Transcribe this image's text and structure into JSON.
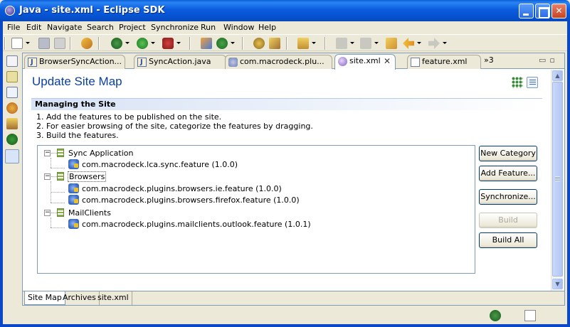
{
  "window": {
    "title": "Java - site.xml - Eclipse SDK"
  },
  "menubar": [
    "File",
    "Edit",
    "Navigate",
    "Search",
    "Project",
    "Synchronize",
    "Run",
    "Window",
    "Help"
  ],
  "toolbar_icons": [
    "new-icon",
    "save-icon",
    "print-icon",
    "refresh-icon",
    "debug-icon",
    "run-icon",
    "external-tools-icon",
    "open-type-icon",
    "new-class-icon",
    "search-icon",
    "open-task-icon",
    "open-perspective-icon",
    "next-annotation-icon",
    "previous-annotation-icon",
    "last-edit-icon",
    "back-icon",
    "forward-icon"
  ],
  "left_icons": [
    "package-explorer-icon",
    "junit-icon",
    "hierarchy-icon",
    "outline-icon",
    "problems-icon",
    "debug-view-icon",
    "java-perspective-icon"
  ],
  "tabs": [
    {
      "label": "BrowserSyncAction...",
      "icon": "java-file-icon"
    },
    {
      "label": "SyncAction.java",
      "icon": "java-file-icon"
    },
    {
      "label": "com.macrodeck.plu...",
      "icon": "plugin-icon"
    },
    {
      "label": "site.xml",
      "icon": "site-xml-icon",
      "active": true
    },
    {
      "label": "feature.xml",
      "icon": "feature-xml-icon"
    }
  ],
  "tab_overflow": "»3",
  "form": {
    "title": "Update Site Map",
    "section_title": "Managing the Site",
    "steps": [
      "1. Add the features to be published on the site.",
      "2. For easier browsing of the site, categorize the features by dragging.",
      "3. Build the features."
    ]
  },
  "tree": [
    {
      "type": "category",
      "label": "Sync Application",
      "children": [
        "com.macrodeck.lca.sync.feature (1.0.0)"
      ]
    },
    {
      "type": "category",
      "label": "Browsers",
      "selected": true,
      "children": [
        "com.macrodeck.plugins.browsers.ie.feature (1.0.0)",
        "com.macrodeck.plugins.browsers.firefox.feature (1.0.0)"
      ]
    },
    {
      "type": "category",
      "label": "MailClients",
      "children": [
        "com.macrodeck.plugins.mailclients.outlook.feature (1.0.1)"
      ]
    }
  ],
  "buttons": {
    "new_category": "New Category",
    "add_feature": "Add Feature...",
    "synchronize": "Synchronize...",
    "build": "Build",
    "build_all": "Build All"
  },
  "bottom_tabs": [
    "Site Map",
    "Archives",
    "site.xml"
  ]
}
